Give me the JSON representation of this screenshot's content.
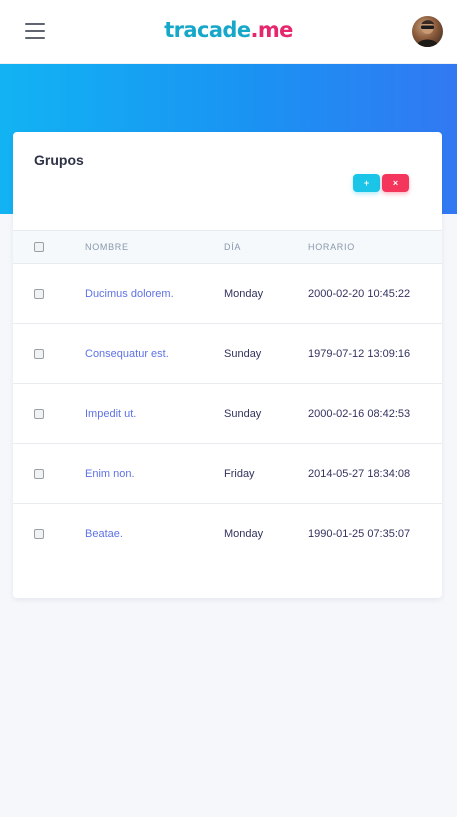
{
  "header": {
    "logo_part1": "tracade",
    "logo_part2": ".me",
    "menu_icon": "hamburger-menu-icon",
    "avatar_icon": "user-avatar"
  },
  "card": {
    "title": "Grupos",
    "add_label": "+",
    "delete_label": "×"
  },
  "table": {
    "columns": [
      "NOMBRE",
      "DÍA",
      "HORARIO"
    ],
    "rows": [
      {
        "nombre": "Ducimus dolorem.",
        "dia": "Monday",
        "horario": "2000-02-20 10:45:22"
      },
      {
        "nombre": "Consequatur est.",
        "dia": "Sunday",
        "horario": "1979-07-12 13:09:16"
      },
      {
        "nombre": "Impedit ut.",
        "dia": "Sunday",
        "horario": "2000-02-16 08:42:53"
      },
      {
        "nombre": "Enim non.",
        "dia": "Friday",
        "horario": "2014-05-27 18:34:08"
      },
      {
        "nombre": "Beatae.",
        "dia": "Monday",
        "horario": "1990-01-25 07:35:07"
      }
    ]
  },
  "colors": {
    "brand_teal": "#17a8c9",
    "brand_pink": "#e5286e",
    "hero_start": "#12b3f3",
    "hero_end": "#3278f2",
    "add_button": "#1ac5e8",
    "delete_button": "#f5365c",
    "link": "#5e72e4"
  }
}
